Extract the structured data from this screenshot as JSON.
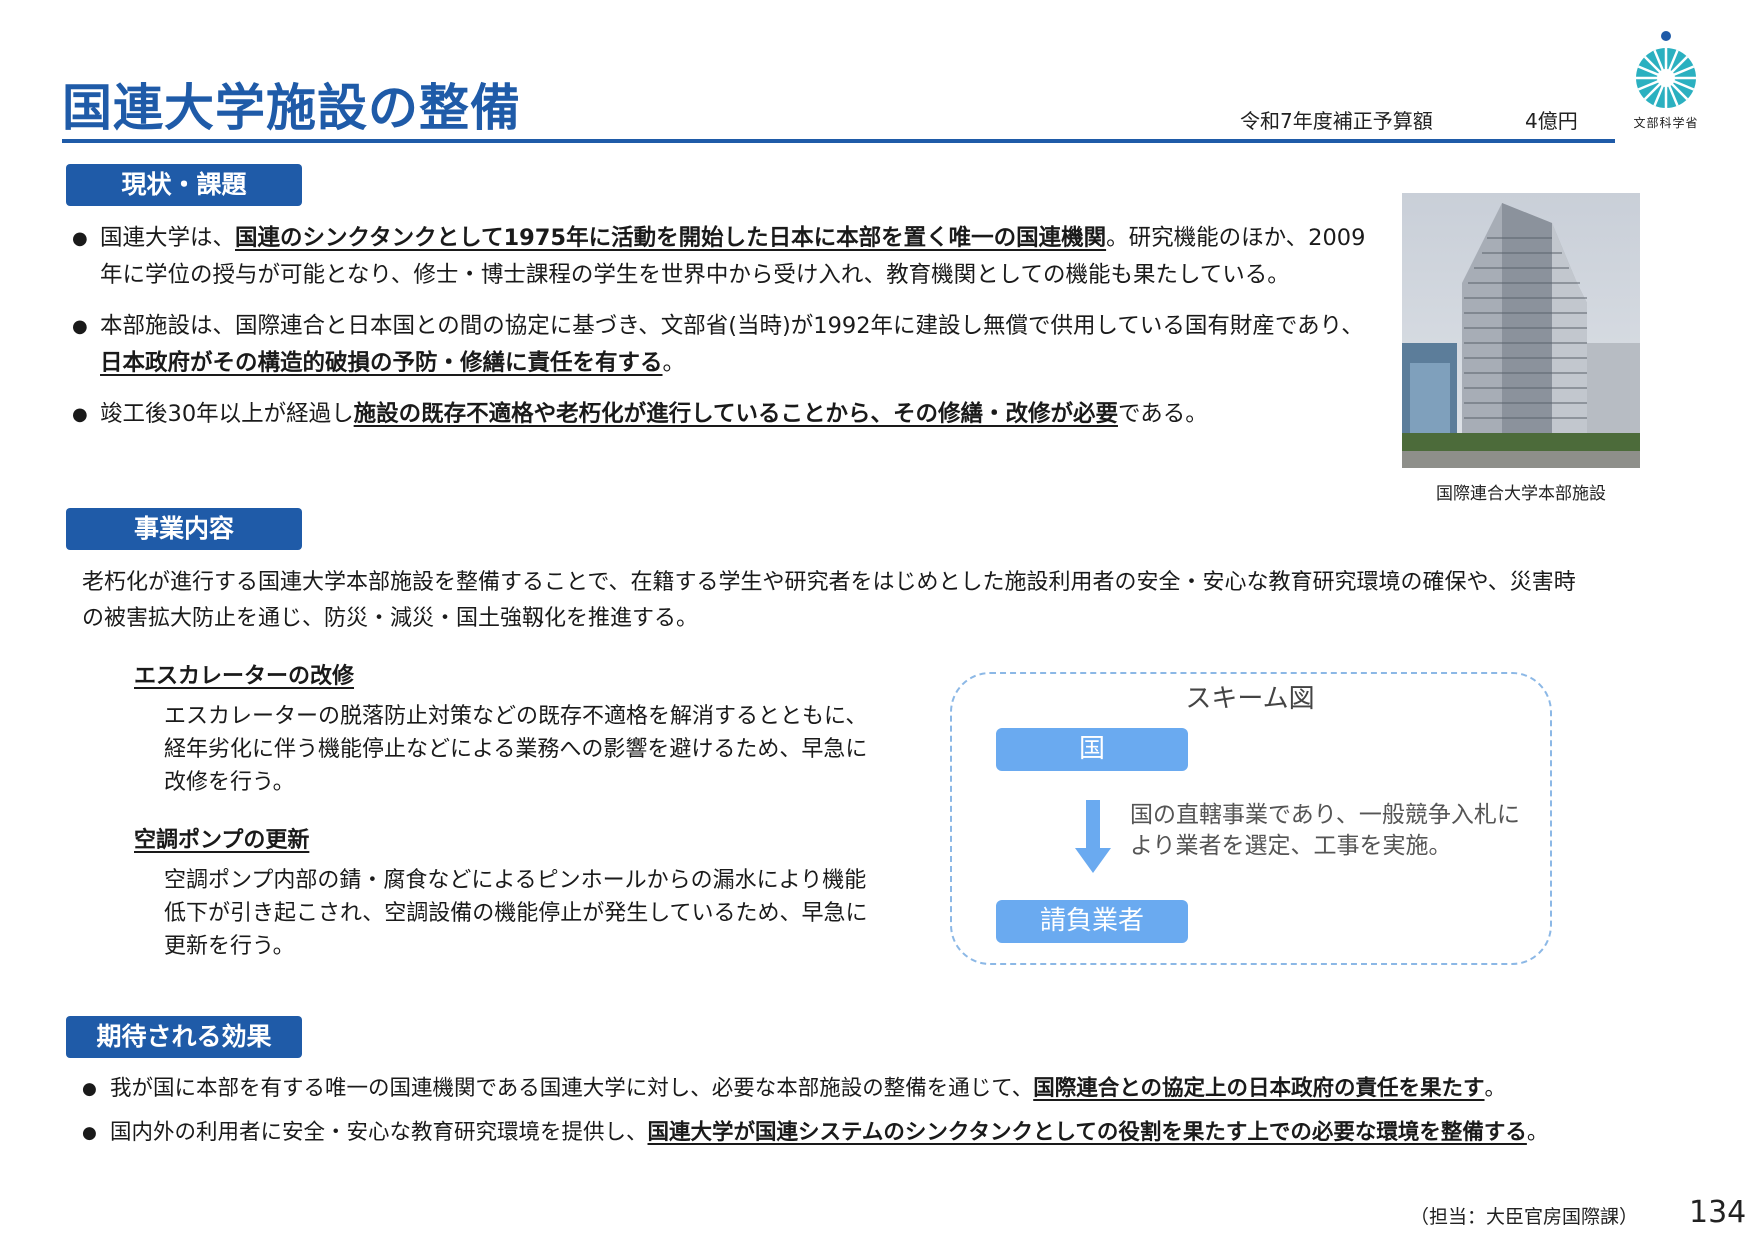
{
  "header": {
    "title": "国連大学施設の整備",
    "budget_label": "令和7年度補正予算額",
    "budget_amount": "4億円",
    "logo_text": "文部科学省"
  },
  "sections": {
    "current_status": "現状・課題",
    "business": "事業内容",
    "effects": "期待される効果"
  },
  "status_bullets": [
    {
      "pre": "国連大学は、",
      "em": "国連のシンクタンクとして1975年に活動を開始した日本に本部を置く唯一の国連機関",
      "post": "。研究機能のほか、2009年に学位の授与が可能となり、修士・博士課程の学生を世界中から受け入れ、教育機関としての機能も果たしている。"
    },
    {
      "pre": "本部施設は、国際連合と日本国との間の協定に基づき、文部省(当時)が1992年に建設し無償で供用している国有財産であり、",
      "em": "日本政府がその構造的破損の予防・修繕に責任を有する",
      "post": "。"
    },
    {
      "pre": "竣工後30年以上が経過し",
      "em": "施設の既存不適格や老朽化が進行していることから、その修繕・改修が必要",
      "post": "である。"
    }
  ],
  "photo_caption": "国際連合大学本部施設",
  "business_text": "老朽化が進行する国連大学本部施設を整備することで、在籍する学生や研究者をはじめとした施設利用者の安全・安心な教育研究環境の確保や、災害時の被害拡大防止を通じ、防災・減災・国土強靱化を推進する。",
  "items": [
    {
      "heading": "エスカレーターの改修",
      "body": "エスカレーターの脱落防止対策などの既存不適格を解消するとともに、経年劣化に伴う機能停止などによる業務への影響を避けるため、早急に改修を行う。"
    },
    {
      "heading": "空調ポンプの更新",
      "body": "空調ポンプ内部の錆・腐食などによるピンホールからの漏水により機能低下が引き起こされ、空調設備の機能停止が発生しているため、早急に更新を行う。"
    }
  ],
  "scheme": {
    "title": "スキーム図",
    "top_node": "国",
    "bottom_node": "請負業者",
    "description": "国の直轄事業であり、一般競争入札により業者を選定、工事を実施。"
  },
  "effect_bullets": [
    {
      "pre": "我が国に本部を有する唯一の国連機関である国連大学に対し、必要な本部施設の整備を通じて、",
      "em": "国際連合との協定上の日本政府の責任を果たす",
      "post": "。"
    },
    {
      "pre": "国内外の利用者に安全・安心な教育研究環境を提供し、",
      "em": "国連大学が国連システムのシンクタンクとしての役割を果たす上での必要な環境を整備する",
      "post": "。"
    }
  ],
  "footer": {
    "contact": "（担当：大臣官房国際課）",
    "page_number": "134"
  },
  "colors": {
    "brand_blue": "#1f5ba8",
    "scheme_node": "#6aaaf0",
    "scheme_border": "#8cb8e6",
    "logo_teal": "#2bb0c0"
  },
  "icons": [
    "mext-logo-icon",
    "down-arrow-icon",
    "bullet-icon"
  ]
}
